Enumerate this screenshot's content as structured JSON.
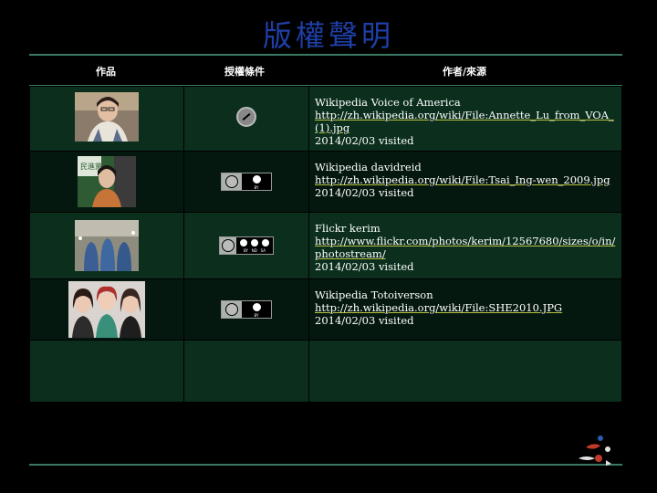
{
  "title": "版權聲明",
  "columns": [
    "作品",
    "授權條件",
    "作者/來源"
  ],
  "rows": [
    {
      "photo": "woman-glasses-portrait",
      "license_icon": "public-domain-icon",
      "source_name": "Wikipedia Voice of America",
      "url": "http://zh.wikipedia.org/wiki/File:Annette_Lu_from_VOA_(1).jpg",
      "date": "2014/02/03 visited"
    },
    {
      "photo": "woman-speaker-portrait",
      "license_icon": "cc-by-icon",
      "source_name": "Wikipedia davidreid",
      "url": "http://zh.wikipedia.org/wiki/File:Tsai_Ing-wen_2009.jpg",
      "date": "2014/02/03 visited"
    },
    {
      "photo": "blue-burqa-women-photo",
      "license_icon": "cc-by-nd-sa-icon",
      "source_name": "Flickr kerim",
      "url": "http://www.flickr.com/photos/kerim/12567680/sizes/o/in/photostream/",
      "date": "2014/02/03 visited"
    },
    {
      "photo": "three-women-group-photo",
      "license_icon": "cc-by-icon",
      "source_name": "Wikipedia Totoiverson",
      "url": "http://zh.wikipedia.org/wiki/File:SHE2010.JPG",
      "date": "2014/02/03 visited"
    },
    {
      "photo": "",
      "license_icon": "",
      "source_name": "",
      "url": "",
      "date": ""
    }
  ],
  "badge_text": {
    "by": "BY",
    "by_nd_sa": "BY   ND   SA"
  },
  "colors": {
    "title": "#1f3fa8",
    "rule": "#3a7a64",
    "row_odd": "#0b2e1d",
    "row_even": "#05180f"
  }
}
